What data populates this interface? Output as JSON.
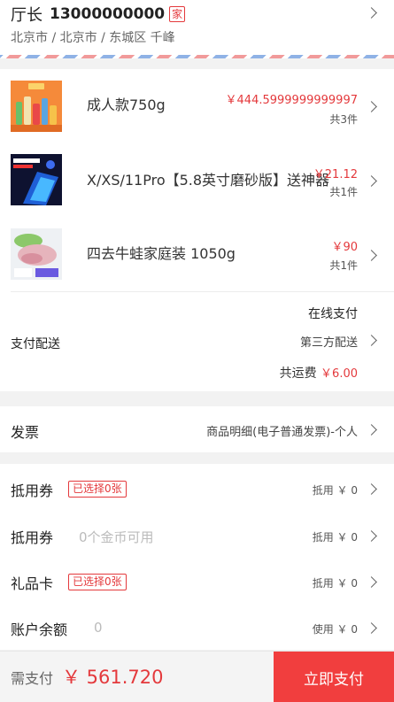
{
  "address": {
    "name": "厅长",
    "phone": "13000000000",
    "tag": "家",
    "detail": "北京市 / 北京市 / 东城区 千峰"
  },
  "goods": [
    {
      "name": "成人款750g",
      "price": "￥444.5999999999997",
      "count": "共3件",
      "image": "supermarket-drinks-thumbnail"
    },
    {
      "name": "X/XS/11Pro【5.8英寸磨砂版】送神器",
      "price": "￥21.12",
      "count": "共1件",
      "image": "phone-case-thumbnail"
    },
    {
      "name": "四去牛蛙家庭装 1050g",
      "price": "￥90",
      "count": "共1件",
      "image": "bullfrog-meat-thumbnail"
    }
  ],
  "shipping": {
    "label": "支付配送",
    "payment": "在线支付",
    "method": "第三方配送",
    "fee_label": "共运费",
    "fee": "￥6.00"
  },
  "invoice": {
    "label": "发票",
    "value": "商品明细(电子普通发票)-个人"
  },
  "discounts": [
    {
      "label": "抵用券",
      "tag": "已选择0张",
      "hint": "",
      "right": "抵用 ￥ 0"
    },
    {
      "label": "抵用券",
      "tag": "",
      "hint": "0个金币可用",
      "right": "抵用 ￥ 0"
    },
    {
      "label": "礼品卡",
      "tag": "已选择0张",
      "hint": "",
      "right": "抵用 ￥ 0"
    },
    {
      "label": "账户余额",
      "tag": "",
      "hint": "0",
      "right": "使用 ￥ 0"
    }
  ],
  "footer": {
    "pay_label": "需支付",
    "amount": "￥ 561.720",
    "button": "立即支付"
  },
  "colors": {
    "accent": "#e4393c",
    "button": "#f13e3e"
  }
}
